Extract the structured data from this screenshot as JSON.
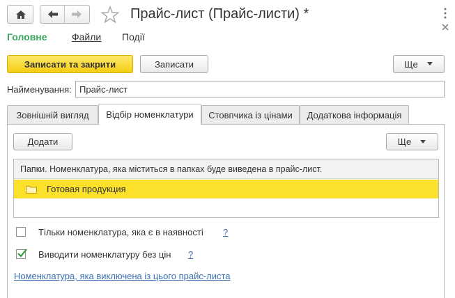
{
  "window": {
    "title": "Прайс-лист (Прайс-листи) *"
  },
  "icons": {
    "home": "home-icon",
    "back": "arrow-left-icon",
    "forward": "arrow-right-icon",
    "favorite": "star-icon",
    "more": "vertical-ellipsis-icon",
    "close": "close-icon",
    "folder": "folder-icon",
    "dropdown": "triangle-down-icon",
    "checkbox": "checkmark-icon"
  },
  "menu": {
    "main": "Головне",
    "files": "Файли",
    "events": "Події"
  },
  "toolbar": {
    "save_close": "Записати та закрити",
    "save": "Записати",
    "more": "Ще"
  },
  "form": {
    "name_label": "Найменування:",
    "name_value": "Прайс-лист"
  },
  "tabs": [
    {
      "label": "Зовнішній вигляд"
    },
    {
      "label": "Відбір номенклатури"
    },
    {
      "label": "Стовпчика із цінами"
    },
    {
      "label": "Додаткова інформація"
    }
  ],
  "tab_content": {
    "add_button": "Додати",
    "more_button": "Ще",
    "table_header": "Папки. Номенклатура, яка міститься в папках буде виведена в прайс-лист.",
    "rows": [
      {
        "label": "Готовая продукция",
        "selected": true
      }
    ],
    "only_available": {
      "label": "Тільки номенклатура, яка є в наявності",
      "checked": false,
      "help": "?"
    },
    "no_prices": {
      "label": "Виводити номенклатуру без цін",
      "checked": true,
      "help": "?"
    },
    "included_link": "Номенклатура, яка виключена із цього прайс-листа"
  },
  "colors": {
    "accent_yellow": "#fad924",
    "selected_row": "#fbe02c",
    "menu_active": "#3aa35e",
    "link": "#3a6fb0",
    "check": "#2f9d3c"
  }
}
